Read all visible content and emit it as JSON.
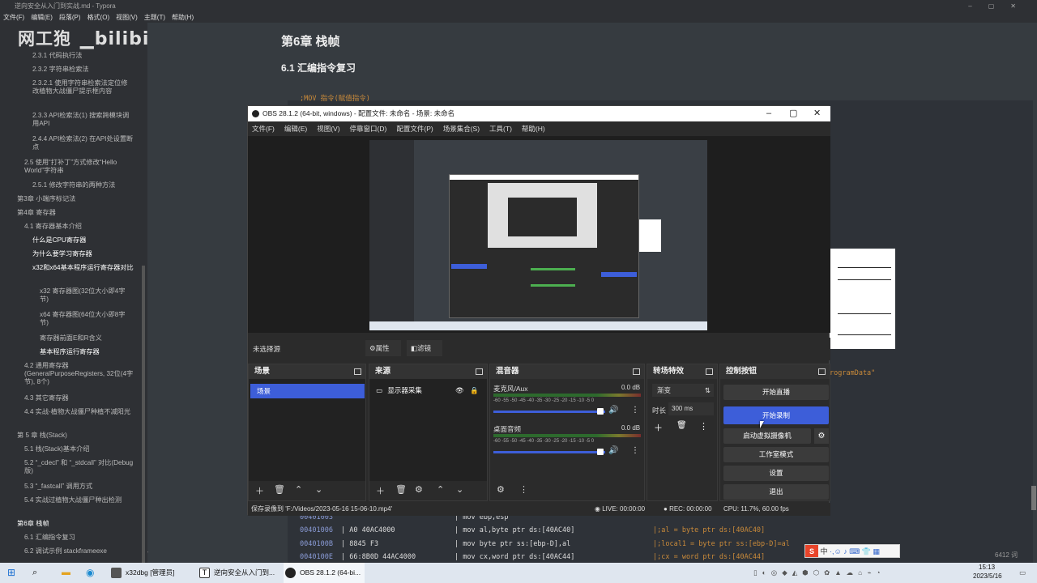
{
  "typora": {
    "title": "逆向安全从入门到实战.md - Typora",
    "menu": [
      "文件(F)",
      "编辑(E)",
      "段落(P)",
      "格式(O)",
      "视图(V)",
      "主题(T)",
      "帮助(H)"
    ],
    "watermark": "网工狍",
    "sidebar": [
      "2.3.1 代码执行法",
      "2.3.2 字符串检索法",
      "2.3.2.1 使用字符串检索法定位修改植物大战僵尸提示框内容",
      "2.3.3 API检索法(1) 搜索跨模块调用API",
      "2.4.4 API检索法(2) 在API处设置断点",
      "2.5 使用“打补丁”方式修改“Hello World”字符串",
      "2.5.1 修改字符串的两种方法",
      "第3章 小端序标记法",
      "第4章 寄存器",
      "4.1 寄存器基本介绍",
      "什么是CPU寄存器",
      "为什么要学习寄存器",
      "x32和x64基本程序运行寄存器对比",
      "x32 寄存器图(32位大小即4字节)",
      "x64 寄存器图(64位大小即8字节)",
      "寄存器前面E和R含义",
      "基本程序运行寄存器",
      "4.2 通用寄存器(GeneralPurposeRegisters, 32位(4字节), 8个)",
      "4.3 其它寄存器",
      "4.4 实战-植物大战僵尸种植不减阳光",
      "第 5 章 栈(Stack)",
      "5.1 栈(Stack)基本介绍",
      "5.2 “_cdecl” 和 “_stdcall” 对比(Debug版)",
      "5.3 “_fastcall” 调用方式",
      "5.4 实战过植物大战僵尸种出检测",
      "第6章 栈帧",
      "6.1 汇编指令复习",
      "6.2 调试示例 stackframeexe"
    ],
    "heading1": "第6章 栈帧",
    "heading2": "6.1 汇编指令复习",
    "code_comment_top": ";MOV 指令(赋值指令)",
    "code_rows": [
      {
        "addr": "00401003",
        "bytes": "",
        "asm": "| mov ebp,esp",
        "comment": ""
      },
      {
        "addr": "00401006",
        "bytes": "| A0 40AC4000",
        "asm": "| mov al,byte ptr ds:[40AC40]",
        "comment": "|;al = byte ptr ds:[40AC40]"
      },
      {
        "addr": "0040100B",
        "bytes": "| 8845 F3",
        "asm": "| mov byte ptr ss:[ebp-D],al",
        "comment": "|;local1 = byte ptr ss:[ebp-D]=al"
      },
      {
        "addr": "0040100E",
        "bytes": "| 66:8B0D 44AC4000",
        "asm": "| mov cx,word ptr ds:[40AC44]",
        "comment": "|;cx = word ptr ds:[40AC44]"
      }
    ],
    "right_snippet": "rogramData\"",
    "word_count": "6412 词"
  },
  "obs": {
    "title": "OBS 28.1.2 (64-bit, windows) - 配置文件: 未命名 - 场景: 未命名",
    "menu": [
      "文件(F)",
      "编辑(E)",
      "视图(V)",
      "停靠窗口(D)",
      "配置文件(P)",
      "场景集合(S)",
      "工具(T)",
      "帮助(H)"
    ],
    "no_source": "未选择源",
    "props_btn": "属性",
    "filters_btn": "滤镜",
    "docks": {
      "scenes": {
        "title": "场景",
        "items": [
          "场景"
        ]
      },
      "sources": {
        "title": "来源",
        "items": [
          "显示器采集"
        ]
      },
      "mixer": {
        "title": "混音器",
        "channels": [
          {
            "name": "麦克风/Aux",
            "db": "0.0 dB"
          },
          {
            "name": "桌面音频",
            "db": "0.0 dB"
          }
        ],
        "scale": "-60 -55 -50 -45 -40 -35 -30 -25 -20 -15 -10 -5 0"
      },
      "transitions": {
        "title": "转场特效",
        "type": "渐变",
        "duration_label": "时长",
        "duration": "300 ms"
      },
      "controls": {
        "title": "控制按钮",
        "buttons": [
          "开始直播",
          "开始录制",
          "启动虚拟摄像机",
          "工作室模式",
          "设置",
          "退出"
        ]
      }
    },
    "status": {
      "saved": "保存录像到 'F:/Videos/2023-05-16 15-06-10.mp4'",
      "live": "LIVE: 00:00:00",
      "rec": "REC: 00:00:00",
      "cpu": "CPU: 11.7%, 60.00 fps"
    },
    "accent": "#3d5ed9"
  },
  "taskbar": {
    "apps": [
      "x32dbg [管理员]",
      "逆向安全从入门到...",
      "OBS 28.1.2 (64-bi..."
    ],
    "time": "15:13",
    "date": "2023/5/16",
    "ime": "中"
  }
}
